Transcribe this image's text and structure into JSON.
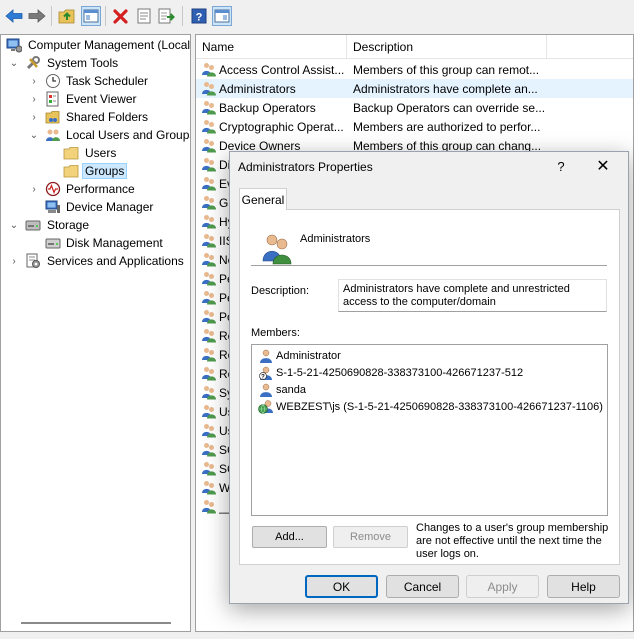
{
  "toolbar": {
    "buttons": [
      "back-arrow-icon",
      "forward-arrow-icon",
      "up-folder-icon",
      "show-hide-tree-icon",
      "delete-icon",
      "properties-icon",
      "export-list-icon",
      "help-icon",
      "show-hide-action-pane-icon"
    ]
  },
  "tree": {
    "root": "Computer Management (Local",
    "system_tools": "System Tools",
    "task_scheduler": "Task Scheduler",
    "event_viewer": "Event Viewer",
    "shared_folders": "Shared Folders",
    "local_users_groups": "Local Users and Groups",
    "users": "Users",
    "groups": "Groups",
    "performance": "Performance",
    "device_manager": "Device Manager",
    "storage": "Storage",
    "disk_management": "Disk Management",
    "services_apps": "Services and Applications"
  },
  "list": {
    "col_name": "Name",
    "col_description": "Description",
    "rows": [
      {
        "name": "Access Control Assist...",
        "desc": "Members of this group can remot..."
      },
      {
        "name": "Administrators",
        "desc": "Administrators have complete an..."
      },
      {
        "name": "Backup Operators",
        "desc": "Backup Operators can override se..."
      },
      {
        "name": "Cryptographic Operat...",
        "desc": "Members are authorized to perfor..."
      },
      {
        "name": "Device Owners",
        "desc": "Members of this group can chang..."
      },
      {
        "name": "Di",
        "desc": ""
      },
      {
        "name": "Ev",
        "desc": ""
      },
      {
        "name": "Gu",
        "desc": ""
      },
      {
        "name": "Hy",
        "desc": ""
      },
      {
        "name": "IIS",
        "desc": ""
      },
      {
        "name": "Ne",
        "desc": ""
      },
      {
        "name": "Pe",
        "desc": ""
      },
      {
        "name": "Pe",
        "desc": ""
      },
      {
        "name": "Po",
        "desc": ""
      },
      {
        "name": "Re",
        "desc": ""
      },
      {
        "name": "Re",
        "desc": ""
      },
      {
        "name": "Re",
        "desc": ""
      },
      {
        "name": "Sy",
        "desc": ""
      },
      {
        "name": "Us",
        "desc": ""
      },
      {
        "name": "Us",
        "desc": ""
      },
      {
        "name": "SC",
        "desc": ""
      },
      {
        "name": "SC",
        "desc": ""
      },
      {
        "name": "W",
        "desc": ""
      },
      {
        "name": "__",
        "desc": ""
      }
    ]
  },
  "dialog": {
    "title": "Administrators Properties",
    "help": "?",
    "close": "✕",
    "tab_general": "General",
    "group_name": "Administrators",
    "description_label": "Description:",
    "description_value": "Administrators have complete and unrestricted access to the computer/domain",
    "members_label": "Members:",
    "members": [
      {
        "icon": "user-icon",
        "text": "Administrator"
      },
      {
        "icon": "unknown-user-icon",
        "text": "S-1-5-21-4250690828-338373100-426671237-512"
      },
      {
        "icon": "user-icon",
        "text": "sanda"
      },
      {
        "icon": "domain-user-icon",
        "text": "WEBZEST\\js (S-1-5-21-4250690828-338373100-426671237-1106)"
      }
    ],
    "add_button": "Add...",
    "remove_button": "Remove",
    "note": "Changes to a user's group membership are not effective until the next time the user logs on.",
    "ok": "OK",
    "cancel": "Cancel",
    "apply": "Apply",
    "help_button": "Help"
  }
}
